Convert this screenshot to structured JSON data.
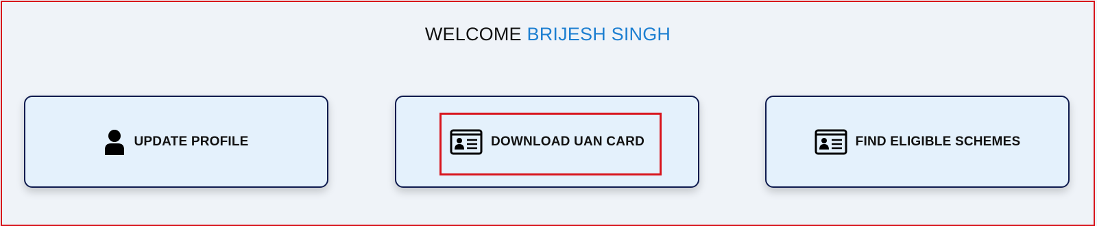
{
  "header": {
    "welcome_label": "WELCOME",
    "user_name": "BRIJESH SINGH",
    "name_color": "#1d7fd1"
  },
  "cards": [
    {
      "label": "UPDATE PROFILE",
      "icon": "user-icon"
    },
    {
      "label": "DOWNLOAD UAN CARD",
      "icon": "id-card-icon",
      "highlighted": true
    },
    {
      "label": "FIND ELIGIBLE SCHEMES",
      "icon": "id-card-icon"
    }
  ],
  "colors": {
    "card_bg": "#e4f1fc",
    "card_border": "#0e1a4e",
    "highlight": "#d8141c",
    "page_bg": "#eff3f8"
  }
}
